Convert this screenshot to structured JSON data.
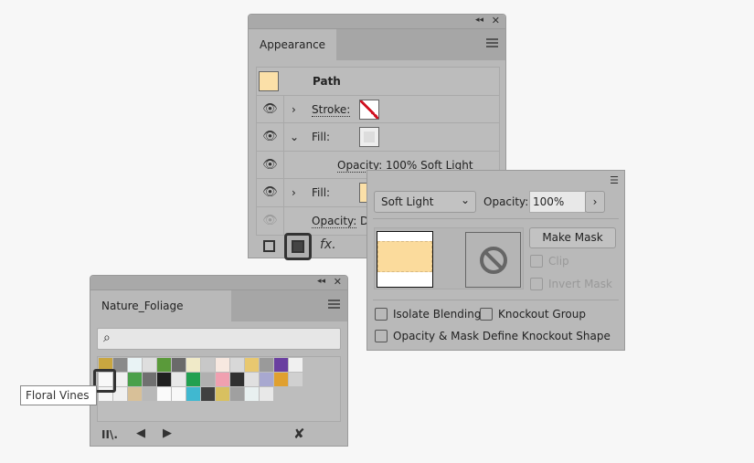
{
  "appearance": {
    "tab": "Appearance",
    "title_row": "Path",
    "rows": [
      {
        "label": "Stroke:",
        "chevron": ">",
        "visible": true
      },
      {
        "label": "Fill:",
        "chevron": "v",
        "visible": true
      },
      {
        "label": "Opacity:",
        "value": "100% Soft Light",
        "visible": true
      },
      {
        "label": "Fill:",
        "chevron": ">",
        "visible": true
      },
      {
        "label": "Opacity:",
        "value": "D",
        "visible": false
      }
    ],
    "footer": {
      "fx": "fx."
    }
  },
  "transparency": {
    "blend_mode": "Soft Light",
    "opacity_label": "Opacity:",
    "opacity_value": "100%",
    "make_mask": "Make Mask",
    "clip": "Clip",
    "invert_mask": "Invert Mask",
    "isolate": "Isolate Blending",
    "knockout": "Knockout Group",
    "define_knockout": "Opacity & Mask Define Knockout Shape"
  },
  "swatches": {
    "tab": "Nature_Foliage",
    "tooltip": "Floral Vines",
    "search_placeholder": "",
    "colors": [
      [
        "#c9a640",
        "#8a8a8a",
        "#e9f3f5",
        "#dedede",
        "#5a9a3a",
        "#6a6a6a",
        "#f0eac8",
        "#c8c8c8",
        "#f7e8e0",
        "#d8d8d8",
        "#e8c870",
        "#9a9a9a",
        "#6a3fa0",
        "#f0f0f0"
      ],
      [
        "#f8f8f8",
        "#f0f0f0",
        "#4aa04a",
        "#707070",
        "#202020",
        "#e8e8e8",
        "#22a050",
        "#b0b0b0",
        "#f0a0b0",
        "#303030",
        "#e0e0e0",
        "#a8a8d0",
        "#e0a030",
        "#d0d0d0"
      ],
      [
        "#f5f5f5",
        "#f0f0f0",
        "#d8c098",
        "#b8b8b8",
        "#fafafa",
        "#f8f8f8",
        "#40b8d0",
        "#404040",
        "#d8c060",
        "#a0a0a0",
        "#e8f0f0",
        "#e8e8e8"
      ]
    ]
  },
  "colors": {
    "panel": "#b9b9b9",
    "background": "#f7f7f7"
  }
}
